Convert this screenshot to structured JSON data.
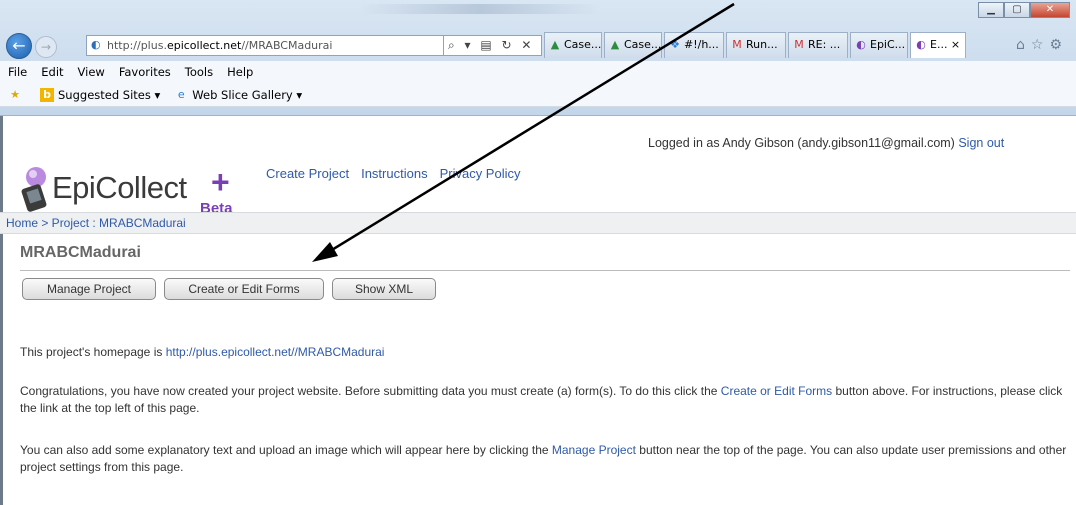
{
  "browser": {
    "url_prefix": "http://plus.",
    "url_domain": "epicollect.net",
    "url_suffix": "//MRABCMadurai",
    "addr_tools": "⌕ ▾ ▤ ↻ ✕",
    "tabs": [
      {
        "label": "Case...",
        "icon": "▲"
      },
      {
        "label": "Case...",
        "icon": "▲"
      },
      {
        "label": "#!/h...",
        "icon": "❖"
      },
      {
        "label": "Run...",
        "icon": "M"
      },
      {
        "label": "RE: ...",
        "icon": "M"
      },
      {
        "label": "EpiC...",
        "icon": "◐"
      },
      {
        "label": "E... ×",
        "icon": "◐"
      }
    ],
    "menu": [
      "File",
      "Edit",
      "View",
      "Favorites",
      "Tools",
      "Help"
    ],
    "favorites": {
      "suggested": "Suggested Sites ▾",
      "webslice": "Web Slice Gallery ▾"
    }
  },
  "site": {
    "logo_text": "EpiCollect",
    "logo_plus": "+",
    "logo_beta": "Beta",
    "nav": [
      "Create Project",
      "Instructions",
      "Privacy Policy"
    ],
    "login_prefix": "Logged in as Andy Gibson (andy.gibson11@gmail.com)",
    "signout": "Sign out",
    "breadcrumb": "Home > Project : MRABCMadurai"
  },
  "project": {
    "title": "MRABCMadurai",
    "buttons": [
      "Manage Project",
      "Create or Edit Forms",
      "Show XML"
    ],
    "p1_text": "This project's homepage is ",
    "p1_link": "http://plus.epicollect.net//MRABCMadurai",
    "p2_a": "Congratulations, you have now created your project website. Before submitting data you must create (a) form(s). To do this click the ",
    "p2_link": "Create or Edit Forms",
    "p2_b": " button above. For instructions, please click the link at the top left of this page.",
    "p3_a": "You can also add some explanatory text and upload an image which will appear here by clicking the ",
    "p3_link": "Manage Project",
    "p3_b": " button near the top of the page. You can also update user premissions and other project settings from this page."
  },
  "colors": {
    "link": "#2f5aa8",
    "brand_purple": "#7b3fb5"
  }
}
